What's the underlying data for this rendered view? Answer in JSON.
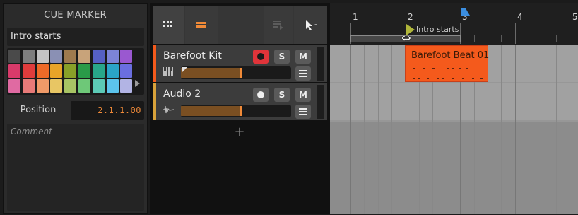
{
  "inspector": {
    "title": "CUE MARKER",
    "marker_name": "Intro starts",
    "palette": [
      "#4a4a4a",
      "#7e7e7e",
      "#c4c4c4",
      "#8a90b4",
      "#9e7a4e",
      "#c8a37a",
      "#5560c4",
      "#7c84d8",
      "#9a58d0",
      "#d83a6a",
      "#e03c3c",
      "#ee6a28",
      "#e8a428",
      "#88a028",
      "#2a9a48",
      "#28a68a",
      "#2aa4c8",
      "#6a6ee0",
      "#e06aa2",
      "#e87a78",
      "#f09a68",
      "#e8c664",
      "#a8c464",
      "#6ec878",
      "#5ccab6",
      "#5cc4ec",
      "#b2b4e4"
    ],
    "position_label": "Position",
    "position_value": "2.1.1.00",
    "comment_placeholder": "Comment"
  },
  "toolbar": {
    "grid_icon": "grid-icon",
    "list_icon": "track-list-icon",
    "doc_icon": "clip-icon",
    "pointer_icon": "pointer-tool-icon"
  },
  "tracks": [
    {
      "name": "Barefoot Kit",
      "color": "#f45a1c",
      "icon": "piano-icon",
      "record_armed": true,
      "solo": "S",
      "mute": "M",
      "volume": 0.55
    },
    {
      "name": "Audio 2",
      "color": "#d8a23a",
      "icon": "waveform-icon",
      "record_armed": false,
      "solo": "S",
      "mute": "M",
      "volume": 0.55
    }
  ],
  "add_track_symbol": "+",
  "arranger": {
    "bars": [
      "1",
      "2",
      "3",
      "4",
      "5"
    ],
    "cue_marker_label": "Intro starts",
    "clip_name": "Barefoot Beat 01",
    "clip_color": "#f45a1c",
    "playhead_color": "#3b8ee0"
  }
}
